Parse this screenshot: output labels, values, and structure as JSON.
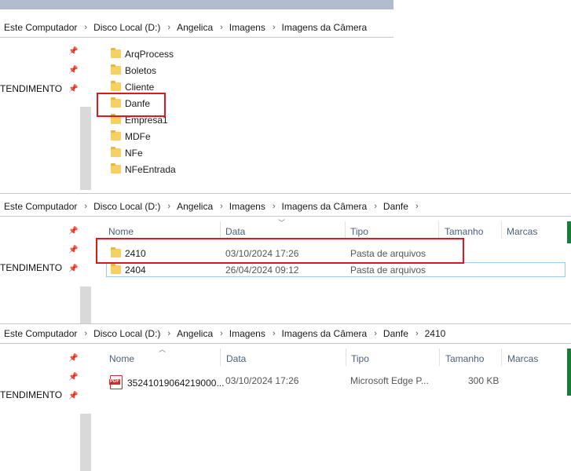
{
  "panel1": {
    "breadcrumb": [
      "Este Computador",
      "Disco Local (D:)",
      "Angelica",
      "Imagens",
      "Imagens da Câmera"
    ],
    "side_label": "TENDIMENTO",
    "folders": [
      "ArqProcess",
      "Boletos",
      "Cliente",
      "Danfe",
      "Empresa1",
      "MDFe",
      "NFe",
      "NFeEntrada"
    ]
  },
  "panel2": {
    "breadcrumb": [
      "Este Computador",
      "Disco Local (D:)",
      "Angelica",
      "Imagens",
      "Imagens da Câmera",
      "Danfe"
    ],
    "side_label": "TENDIMENTO",
    "columns": [
      "Nome",
      "Data",
      "Tipo",
      "Tamanho",
      "Marcas"
    ],
    "rows": [
      {
        "name": "2410",
        "date": "03/10/2024 17:26",
        "type": "Pasta de arquivos"
      },
      {
        "name": "2404",
        "date": "26/04/2024 09:12",
        "type": "Pasta de arquivos"
      }
    ]
  },
  "panel3": {
    "breadcrumb": [
      "Este Computador",
      "Disco Local (D:)",
      "Angelica",
      "Imagens",
      "Imagens da Câmera",
      "Danfe",
      "2410"
    ],
    "side_label": "TENDIMENTO",
    "columns": [
      "Nome",
      "Data",
      "Tipo",
      "Tamanho",
      "Marcas"
    ],
    "rows": [
      {
        "name": "35241019064219000...",
        "date": "03/10/2024 17:26",
        "type": "Microsoft Edge P...",
        "size": "300 KB",
        "icon": "pdf-icon",
        "icon_text": "PDF"
      }
    ]
  },
  "colors": {
    "highlight": "#e3161b",
    "selection_border": "#99c9ef",
    "folder": "#f7d062"
  }
}
